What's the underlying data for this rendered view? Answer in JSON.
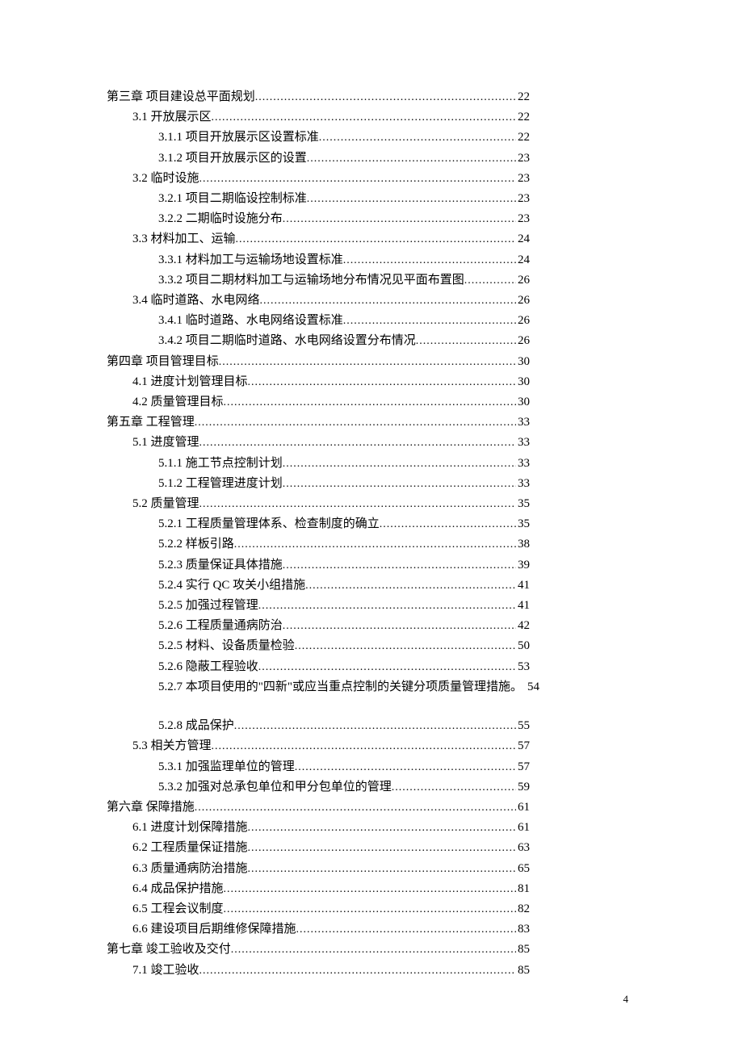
{
  "page_number": "4",
  "toc": [
    {
      "indent": 0,
      "title": "第三章   项目建设总平面规划",
      "page": "22",
      "leader": true
    },
    {
      "indent": 1,
      "title": "3.1 开放展示区",
      "page": "22",
      "leader": true
    },
    {
      "indent": 2,
      "title": "3.1.1 项目开放展示区设置标准",
      "page": "22",
      "leader": true
    },
    {
      "indent": 2,
      "title": "3.1.2 项目开放展示区的设置",
      "page": "23",
      "leader": true
    },
    {
      "indent": 1,
      "title": "3.2 临时设施",
      "page": "23",
      "leader": true
    },
    {
      "indent": 2,
      "title": "3.2.1 项目二期临设控制标准",
      "page": "23",
      "leader": true
    },
    {
      "indent": 2,
      "title": "3.2.2 二期临时设施分布",
      "page": "23",
      "leader": true
    },
    {
      "indent": 1,
      "title": "3.3 材料加工、运输",
      "page": "24",
      "leader": true
    },
    {
      "indent": 2,
      "title": "3.3.1 材料加工与运输场地设置标准",
      "page": "24",
      "leader": true
    },
    {
      "indent": 2,
      "title": "3.3.2 项目二期材料加工与运输场地分布情况见平面布置图",
      "page": "26",
      "leader": true
    },
    {
      "indent": 1,
      "title": "3.4 临时道路、水电网络",
      "page": "26",
      "leader": true
    },
    {
      "indent": 2,
      "title": "3.4.1 临时道路、水电网络设置标准",
      "page": "26",
      "leader": true
    },
    {
      "indent": 2,
      "title": "3.4.2 项目二期临时道路、水电网络设置分布情况",
      "page": "26",
      "leader": true
    },
    {
      "indent": 0,
      "title": "第四章  项目管理目标",
      "page": "30",
      "leader": true
    },
    {
      "indent": 1,
      "title": "4.1 进度计划管理目标",
      "page": "30",
      "leader": true
    },
    {
      "indent": 1,
      "title": "4.2 质量管理目标",
      "page": "30",
      "leader": true
    },
    {
      "indent": 0,
      "title": "第五章  工程管理",
      "page": "33",
      "leader": true
    },
    {
      "indent": 1,
      "title": "5.1 进度管理",
      "page": "33",
      "leader": true
    },
    {
      "indent": 2,
      "title": "5.1.1 施工节点控制计划",
      "page": "33",
      "leader": true
    },
    {
      "indent": 2,
      "title": "5.1.2 工程管理进度计划",
      "page": "33",
      "leader": true
    },
    {
      "indent": 1,
      "title": "5.2 质量管理",
      "page": "35",
      "leader": true
    },
    {
      "indent": 2,
      "title": "5.2.1 工程质量管理体系、检查制度的确立",
      "page": "35",
      "leader": true
    },
    {
      "indent": 2,
      "title": "5.2.2 样板引路",
      "page": "38",
      "leader": true
    },
    {
      "indent": 2,
      "title": "5.2.3  质量保证具体措施",
      "page": "39",
      "leader": true
    },
    {
      "indent": 2,
      "title": "5.2.4 实行 QC 攻关小组措施",
      "page": "41",
      "leader": true
    },
    {
      "indent": 2,
      "title": "5.2.5 加强过程管理",
      "page": "41",
      "leader": true
    },
    {
      "indent": 2,
      "title": "5.2.6 工程质量通病防治",
      "page": "42",
      "leader": true
    },
    {
      "indent": 2,
      "title": "5.2.5 材料、设备质量检验",
      "page": "50",
      "leader": true
    },
    {
      "indent": 2,
      "title": "5.2.6 隐蔽工程验收",
      "page": "53",
      "leader": true
    },
    {
      "indent": 2,
      "title": "5.2.7 本项目使用的\"四新\"或应当重点控制的关键分项质量管理措施。",
      "page": "54",
      "leader": false
    },
    {
      "gap": true
    },
    {
      "indent": 2,
      "title": "5.2.8 成品保护",
      "page": "55",
      "leader": true
    },
    {
      "indent": 1,
      "title": "5.3  相关方管理",
      "page": "57",
      "leader": true
    },
    {
      "indent": 2,
      "title": "5.3.1  加强监理单位的管理",
      "page": "57",
      "leader": true
    },
    {
      "indent": 2,
      "title": "5.3.2  加强对总承包单位和甲分包单位的管理",
      "page": "59",
      "leader": true
    },
    {
      "indent": 0,
      "title": "第六章  保障措施",
      "page": "61",
      "leader": true
    },
    {
      "indent": 1,
      "title": "6.1 进度计划保障措施",
      "page": "61",
      "leader": true
    },
    {
      "indent": 1,
      "title": "6.2 工程质量保证措施",
      "page": "63",
      "leader": true
    },
    {
      "indent": 1,
      "title": "6.3 质量通病防治措施",
      "page": "65",
      "leader": true
    },
    {
      "indent": 1,
      "title": "6.4 成品保护措施",
      "page": "81",
      "leader": true
    },
    {
      "indent": 1,
      "title": "6.5 工程会议制度",
      "page": "82",
      "leader": true
    },
    {
      "indent": 1,
      "title": "6.6  建设项目后期维修保障措施",
      "page": "83",
      "leader": true
    },
    {
      "indent": 0,
      "title": "第七章 竣工验收及交付",
      "page": "85",
      "leader": true
    },
    {
      "indent": 1,
      "title": "7.1 竣工验收",
      "page": "85",
      "leader": true
    }
  ]
}
